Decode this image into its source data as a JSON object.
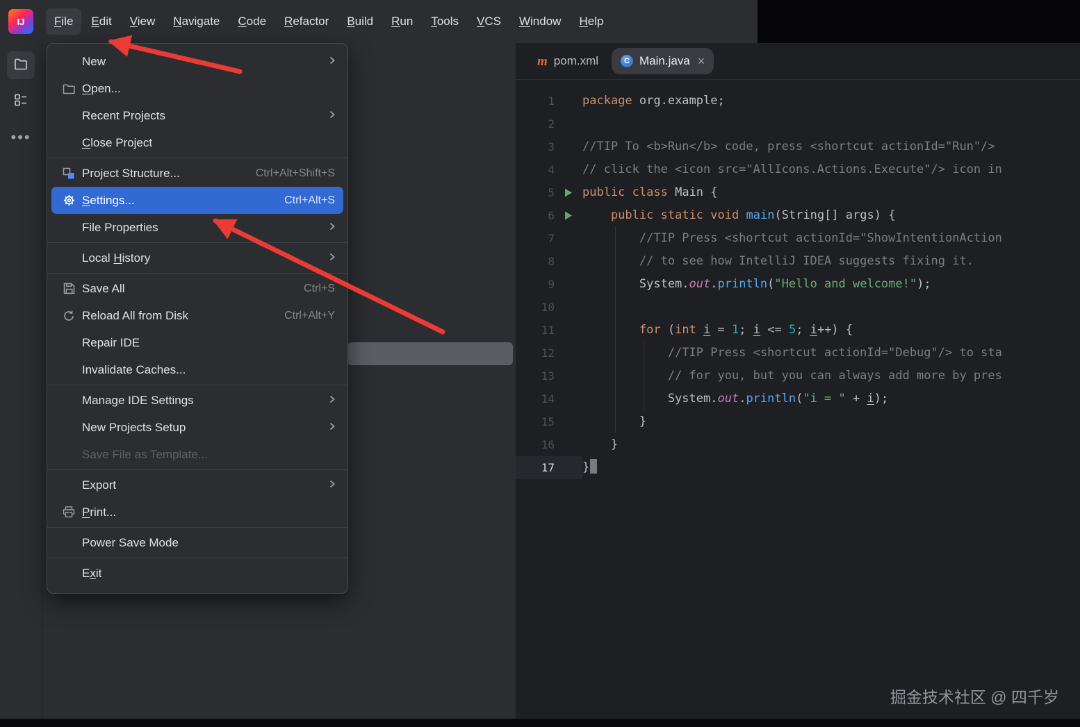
{
  "menu_bar": {
    "items": [
      {
        "label": "File",
        "mnemonic": 0,
        "active": true
      },
      {
        "label": "Edit",
        "mnemonic": 0
      },
      {
        "label": "View",
        "mnemonic": 0
      },
      {
        "label": "Navigate",
        "mnemonic": 0
      },
      {
        "label": "Code",
        "mnemonic": 0
      },
      {
        "label": "Refactor",
        "mnemonic": 0
      },
      {
        "label": "Build",
        "mnemonic": 0
      },
      {
        "label": "Run",
        "mnemonic": 0
      },
      {
        "label": "Tools",
        "mnemonic": 0
      },
      {
        "label": "VCS",
        "mnemonic": 0
      },
      {
        "label": "Window",
        "mnemonic": 0
      },
      {
        "label": "Help",
        "mnemonic": 0
      }
    ]
  },
  "file_menu": {
    "items": [
      {
        "label": "New",
        "submenu": true
      },
      {
        "label": "Open...",
        "icon": "folder",
        "mnemonic": 0
      },
      {
        "label": "Recent Projects",
        "submenu": true
      },
      {
        "label": "Close Project",
        "mnemonic": 0
      },
      {
        "type": "separator"
      },
      {
        "label": "Project Structure...",
        "icon": "project-structure",
        "shortcut": "Ctrl+Alt+Shift+S"
      },
      {
        "label": "Settings...",
        "icon": "gear",
        "shortcut": "Ctrl+Alt+S",
        "selected": true,
        "mnemonic": 0
      },
      {
        "label": "File Properties",
        "submenu": true
      },
      {
        "type": "separator"
      },
      {
        "label": "Local History",
        "submenu": true,
        "mnemonic": 6
      },
      {
        "type": "separator"
      },
      {
        "label": "Save All",
        "icon": "save",
        "shortcut": "Ctrl+S"
      },
      {
        "label": "Reload All from Disk",
        "icon": "reload",
        "shortcut": "Ctrl+Alt+Y"
      },
      {
        "label": "Repair IDE"
      },
      {
        "label": "Invalidate Caches..."
      },
      {
        "type": "separator"
      },
      {
        "label": "Manage IDE Settings",
        "submenu": true
      },
      {
        "label": "New Projects Setup",
        "submenu": true
      },
      {
        "label": "Save File as Template...",
        "disabled": true
      },
      {
        "type": "separator"
      },
      {
        "label": "Export",
        "submenu": true
      },
      {
        "label": "Print...",
        "icon": "printer",
        "mnemonic": 0
      },
      {
        "type": "separator"
      },
      {
        "label": "Power Save Mode"
      },
      {
        "type": "separator"
      },
      {
        "label": "Exit",
        "mnemonic": 1
      }
    ]
  },
  "sidebar": {
    "tools": [
      {
        "name": "project",
        "icon": "folder-tool",
        "active": true
      },
      {
        "name": "structure",
        "icon": "structure-tool",
        "active": false
      },
      {
        "name": "more",
        "icon": "more-dots",
        "active": false
      }
    ]
  },
  "logo_text": "IJ",
  "editor": {
    "tabs": [
      {
        "label": "pom.xml",
        "icon": "maven",
        "selected": false,
        "closable": false
      },
      {
        "label": "Main.java",
        "icon": "java-class",
        "selected": true,
        "closable": true
      }
    ],
    "close_glyph": "×",
    "code_lines": [
      {
        "n": 1,
        "tokens": [
          [
            "k",
            "package"
          ],
          [
            "p",
            " org.example;"
          ]
        ]
      },
      {
        "n": 2,
        "tokens": []
      },
      {
        "n": 3,
        "tokens": [
          [
            "c",
            "//TIP To <b>Run</b> code, press <shortcut actionId=\"Run\"/> "
          ]
        ]
      },
      {
        "n": 4,
        "tokens": [
          [
            "c",
            "// click the <icon src=\"AllIcons.Actions.Execute\"/> icon in"
          ]
        ]
      },
      {
        "n": 5,
        "run": true,
        "tokens": [
          [
            "k",
            "public"
          ],
          [
            "p",
            " "
          ],
          [
            "k",
            "class"
          ],
          [
            "p",
            " Main {"
          ]
        ]
      },
      {
        "n": 6,
        "run": true,
        "tokens": [
          [
            "p",
            "    "
          ],
          [
            "k",
            "public"
          ],
          [
            "p",
            " "
          ],
          [
            "k",
            "static"
          ],
          [
            "p",
            " "
          ],
          [
            "k",
            "void"
          ],
          [
            "p",
            " "
          ],
          [
            "m",
            "main"
          ],
          [
            "p",
            "(String[] args) {"
          ]
        ]
      },
      {
        "n": 7,
        "tokens": [
          [
            "p",
            "        "
          ],
          [
            "c",
            "//TIP Press <shortcut actionId=\"ShowIntentionAction"
          ]
        ]
      },
      {
        "n": 8,
        "tokens": [
          [
            "p",
            "        "
          ],
          [
            "c",
            "// to see how IntelliJ IDEA suggests fixing it."
          ]
        ]
      },
      {
        "n": 9,
        "tokens": [
          [
            "p",
            "        System."
          ],
          [
            "f",
            "out"
          ],
          [
            "p",
            "."
          ],
          [
            "m",
            "println"
          ],
          [
            "p",
            "("
          ],
          [
            "s",
            "\"Hello and welcome!\""
          ],
          [
            "p",
            ");"
          ]
        ]
      },
      {
        "n": 10,
        "tokens": []
      },
      {
        "n": 11,
        "tokens": [
          [
            "p",
            "        "
          ],
          [
            "k",
            "for"
          ],
          [
            "p",
            " ("
          ],
          [
            "k",
            "int"
          ],
          [
            "p",
            " "
          ],
          [
            "v",
            "i"
          ],
          [
            "p",
            " = "
          ],
          [
            "n",
            "1"
          ],
          [
            "p",
            "; "
          ],
          [
            "v",
            "i"
          ],
          [
            "p",
            " <= "
          ],
          [
            "n",
            "5"
          ],
          [
            "p",
            "; "
          ],
          [
            "v",
            "i"
          ],
          [
            "p",
            "++) {"
          ]
        ]
      },
      {
        "n": 12,
        "tokens": [
          [
            "p",
            "            "
          ],
          [
            "c",
            "//TIP Press <shortcut actionId=\"Debug\"/> to sta"
          ]
        ]
      },
      {
        "n": 13,
        "tokens": [
          [
            "p",
            "            "
          ],
          [
            "c",
            "// for you, but you can always add more by pres"
          ]
        ]
      },
      {
        "n": 14,
        "tokens": [
          [
            "p",
            "            System."
          ],
          [
            "f",
            "out"
          ],
          [
            "p",
            "."
          ],
          [
            "m",
            "println"
          ],
          [
            "p",
            "("
          ],
          [
            "s",
            "\"i = \""
          ],
          [
            "p",
            " + "
          ],
          [
            "v",
            "i"
          ],
          [
            "p",
            ");"
          ]
        ]
      },
      {
        "n": 15,
        "tokens": [
          [
            "p",
            "        }"
          ]
        ]
      },
      {
        "n": 16,
        "tokens": [
          [
            "p",
            "    }"
          ]
        ]
      },
      {
        "n": 17,
        "active": true,
        "caret": true,
        "tokens": [
          [
            "p",
            "}"
          ]
        ]
      }
    ]
  },
  "watermark": {
    "text": "掘金技术社区 @ 四千岁"
  },
  "colors": {
    "selection_blue": "#3369d3",
    "arrow_red": "#ea3b36",
    "run_green": "#5fad65"
  }
}
